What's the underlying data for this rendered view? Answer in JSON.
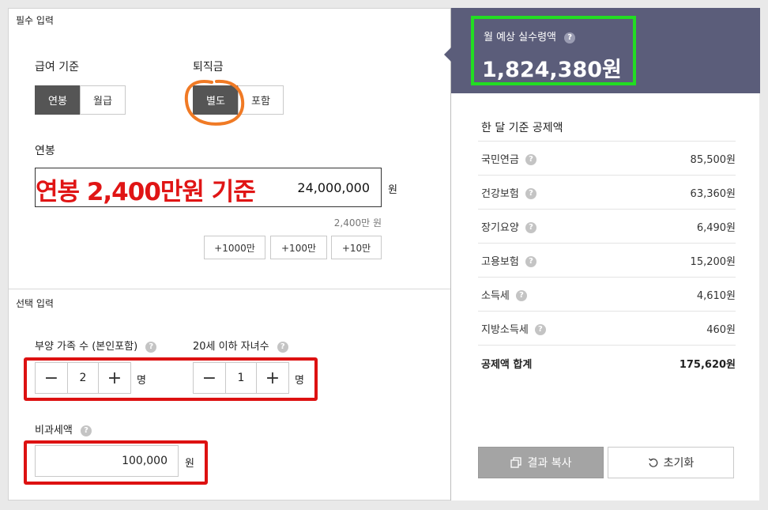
{
  "required": {
    "section_title": "필수 입력",
    "salary_basis": {
      "label": "급여 기준",
      "options": [
        "연봉",
        "월급"
      ],
      "selected": 0
    },
    "severance": {
      "label": "퇴직금",
      "options": [
        "별도",
        "포함"
      ],
      "selected": 0
    },
    "salary_field": {
      "label": "연봉",
      "overlay_text": "연봉 2,400만원 기준",
      "value": "24,000,000",
      "unit": "원",
      "summary": "2,400만 원"
    },
    "increments": [
      "+1000만",
      "+100만",
      "+10만"
    ]
  },
  "optional": {
    "section_title": "선택 입력",
    "dependents": {
      "label": "부양 가족 수 (본인포함)",
      "value": "2",
      "unit": "명"
    },
    "children": {
      "label": "20세 이하 자녀수",
      "value": "1",
      "unit": "명"
    },
    "nontax": {
      "label": "비과세액",
      "value": "100,000",
      "unit": "원"
    }
  },
  "result": {
    "title": "월 예상 실수령액",
    "amount": "1,824,380원",
    "header_color": "#5b5d7a",
    "deductions_title": "한 달 기준 공제액",
    "deductions": [
      {
        "name": "국민연금",
        "amount": "85,500원"
      },
      {
        "name": "건강보험",
        "amount": "63,360원"
      },
      {
        "name": "장기요양",
        "amount": "6,490원"
      },
      {
        "name": "고용보험",
        "amount": "15,200원"
      },
      {
        "name": "소득세",
        "amount": "4,610원"
      },
      {
        "name": "지방소득세",
        "amount": "460원"
      }
    ],
    "total": {
      "name": "공제액 합계",
      "amount": "175,620원"
    },
    "copy_button": "결과 복사",
    "reset_button": "초기화"
  },
  "help_glyph": "?",
  "icons": [
    "help-icon",
    "minus-icon",
    "plus-icon",
    "copy-icon",
    "reset-icon"
  ],
  "highlight_colors": {
    "green": "#22dd22",
    "red": "#dd1111",
    "orange": "#f07a25"
  }
}
